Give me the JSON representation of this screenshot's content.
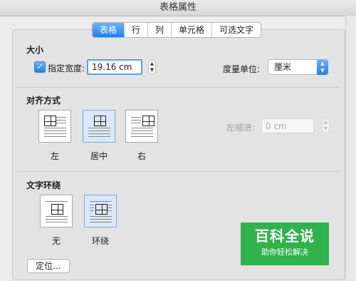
{
  "window": {
    "title": "表格属性"
  },
  "tabs": [
    {
      "label": "表格",
      "active": true
    },
    {
      "label": "行",
      "active": false
    },
    {
      "label": "列",
      "active": false
    },
    {
      "label": "单元格",
      "active": false
    },
    {
      "label": "可选文字",
      "active": false
    }
  ],
  "size": {
    "title": "大小",
    "width_checkbox_label": "指定宽度:",
    "width_checked": true,
    "width_value": "19.16 cm",
    "unit_label": "度量单位:",
    "unit_value": "厘米"
  },
  "alignment": {
    "title": "对齐方式",
    "options": [
      "左",
      "居中",
      "右"
    ],
    "selected": "居中",
    "indent_label": "左缩进:",
    "indent_value": "0 cm"
  },
  "wrapping": {
    "title": "文字环绕",
    "options": [
      "无",
      "环绕"
    ],
    "selected": "环绕"
  },
  "position_button": "定位...",
  "watermark": {
    "main": "百科全说",
    "sub": "助你轻松解决"
  },
  "colors": {
    "accent": "#1e7ff0",
    "watermark": "#2fb34a"
  }
}
